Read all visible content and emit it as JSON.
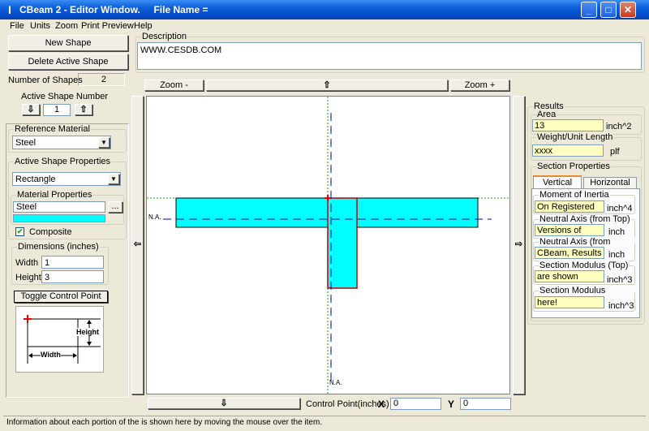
{
  "window": {
    "title": "CBeam 2 - Editor Window.     File Name =",
    "app_icon": "I-beam-icon",
    "controls": [
      "minimize-icon",
      "maximize-icon",
      "close-icon"
    ]
  },
  "menu": [
    "File",
    "Units",
    "Zoom",
    "Print Preview",
    "Help"
  ],
  "left": {
    "new_shape": "New Shape",
    "delete_shape": "Delete Active Shape",
    "num_shapes_label": "Number of Shapes",
    "num_shapes_value": "2",
    "active_shape_label": "Active Shape Number",
    "active_shape_value": "1",
    "reference_material_label": "Reference Material",
    "reference_material_value": "Steel",
    "active_shape_props_label": "Active Shape Properties",
    "shape_type_value": "Rectangle",
    "material_props_label": "Material Properties",
    "material_value": "Steel",
    "material_browse": "...",
    "material_color": "#00ffff",
    "composite_label": "Composite",
    "composite_checked": true,
    "dimensions_label": "Dimensions (inches)",
    "width_label": "Width",
    "width_value": "1",
    "height_label": "Height",
    "height_value": "3",
    "toggle_button": "Toggle Control Point",
    "diagram_height": "Height",
    "diagram_width": "Width"
  },
  "description": {
    "label": "Description",
    "text": "WWW.CESDB.COM"
  },
  "canvas_toolbar": {
    "zoom_out": "Zoom -",
    "zoom_in": "Zoom +"
  },
  "canvas": {
    "na_label_left": "N.A.",
    "na_label_bottom": "N.A.",
    "shape_color": "#00ffff"
  },
  "bottom": {
    "control_point_label": "Control Point(inches)",
    "x_label": "X",
    "x_value": "0",
    "y_label": "Y",
    "y_value": "0"
  },
  "results": {
    "label": "Results",
    "area_label": "Area",
    "area_value": "13",
    "area_unit": "inch^2",
    "weight_label": "Weight/Unit Length",
    "weight_value": "xxxx",
    "weight_unit": "plf",
    "section_props_label": "Section Properties",
    "tabs": [
      "Vertical",
      "Horizontal"
    ],
    "moi_label": "Moment of Inertia",
    "moi_value": "On Registered",
    "moi_unit": "inch^4",
    "na_top_label": "Neutral Axis (from Top)",
    "na_top_value": "Versions of",
    "na_top_unit": "inch",
    "na_bottom_label": "Neutral Axis (from Bottom)",
    "na_bottom_value": "CBeam, Results",
    "na_bottom_unit": "inch",
    "sm_top_label": "Section Modulus (Top)",
    "sm_top_value": "are shown",
    "sm_top_unit": "inch^3",
    "sm_bottom_label": "Section Modulus (Bottom)",
    "sm_bottom_value": "here!",
    "sm_bottom_unit": "inch^3"
  },
  "status": "Information about each portion of the is shown here by moving the mouse over the item."
}
